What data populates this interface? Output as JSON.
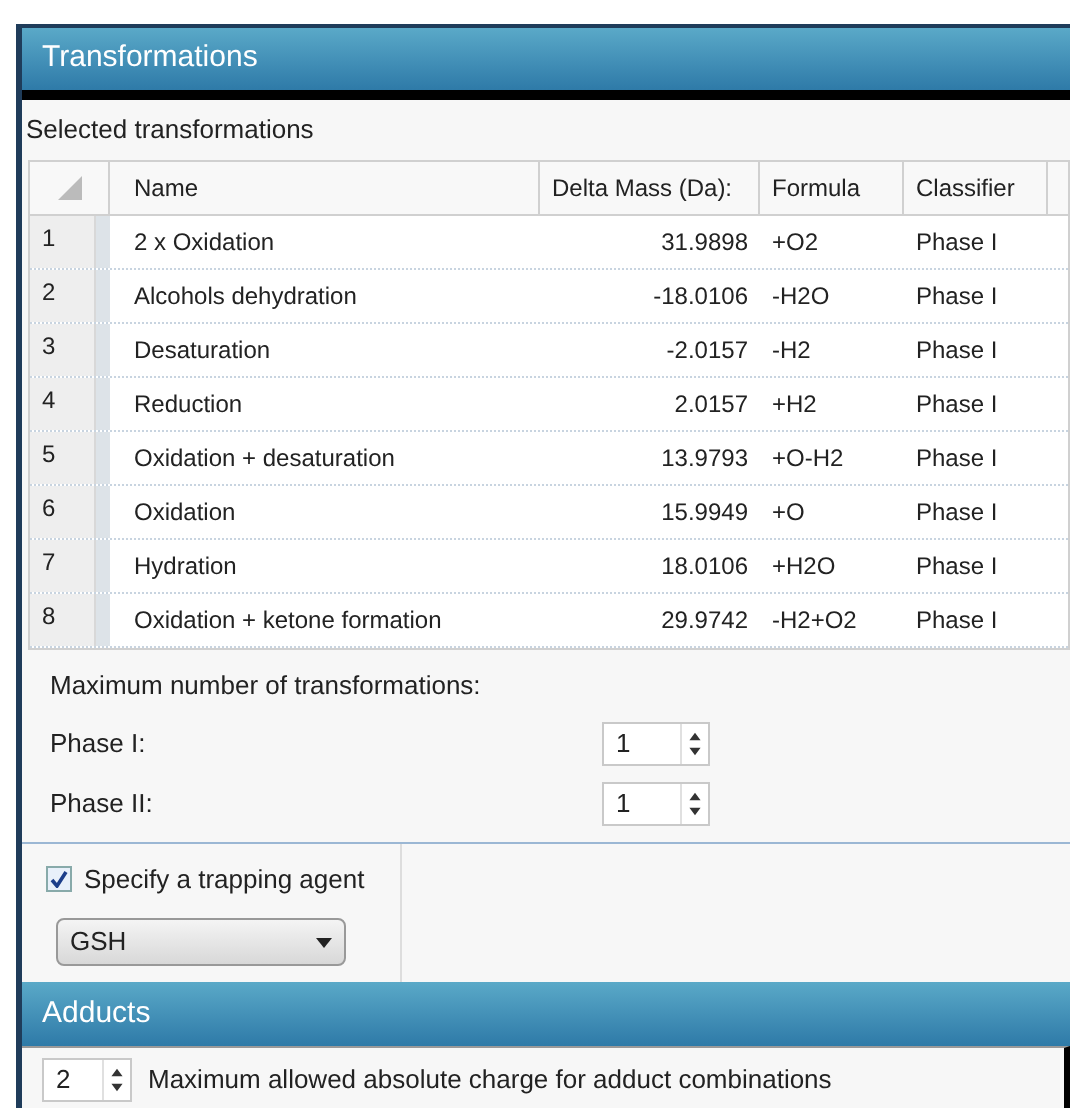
{
  "panel": {
    "title": "Transformations"
  },
  "selected_transformations": {
    "label": "Selected transformations",
    "columns": [
      "Name",
      "Delta Mass (Da):",
      "Formula",
      "Classifier"
    ],
    "rows": [
      {
        "number": "1",
        "name": "2 x Oxidation",
        "delta_mass": "31.9898",
        "formula": "+O2",
        "classifier": "Phase I"
      },
      {
        "number": "2",
        "name": "Alcohols dehydration",
        "delta_mass": "-18.0106",
        "formula": "-H2O",
        "classifier": "Phase I"
      },
      {
        "number": "3",
        "name": "Desaturation",
        "delta_mass": "-2.0157",
        "formula": "-H2",
        "classifier": "Phase I"
      },
      {
        "number": "4",
        "name": "Reduction",
        "delta_mass": "2.0157",
        "formula": "+H2",
        "classifier": "Phase I"
      },
      {
        "number": "5",
        "name": "Oxidation + desaturation",
        "delta_mass": "13.9793",
        "formula": "+O-H2",
        "classifier": "Phase I"
      },
      {
        "number": "6",
        "name": "Oxidation",
        "delta_mass": "15.9949",
        "formula": "+O",
        "classifier": "Phase I"
      },
      {
        "number": "7",
        "name": "Hydration",
        "delta_mass": "18.0106",
        "formula": "+H2O",
        "classifier": "Phase I"
      },
      {
        "number": "8",
        "name": "Oxidation + ketone formation",
        "delta_mass": "29.9742",
        "formula": "-H2+O2",
        "classifier": "Phase I"
      }
    ]
  },
  "maximum": {
    "label": "Maximum number of transformations:",
    "fields": [
      {
        "label": "Phase I:",
        "value": "1"
      },
      {
        "label": "Phase II:",
        "value": "1"
      }
    ]
  },
  "trapping": {
    "label": "Specify a trapping agent",
    "checked": true,
    "agent": "GSH"
  },
  "adducts": {
    "title": "Adducts",
    "value": "2",
    "label": "Maximum allowed absolute charge for adduct combinations"
  }
}
